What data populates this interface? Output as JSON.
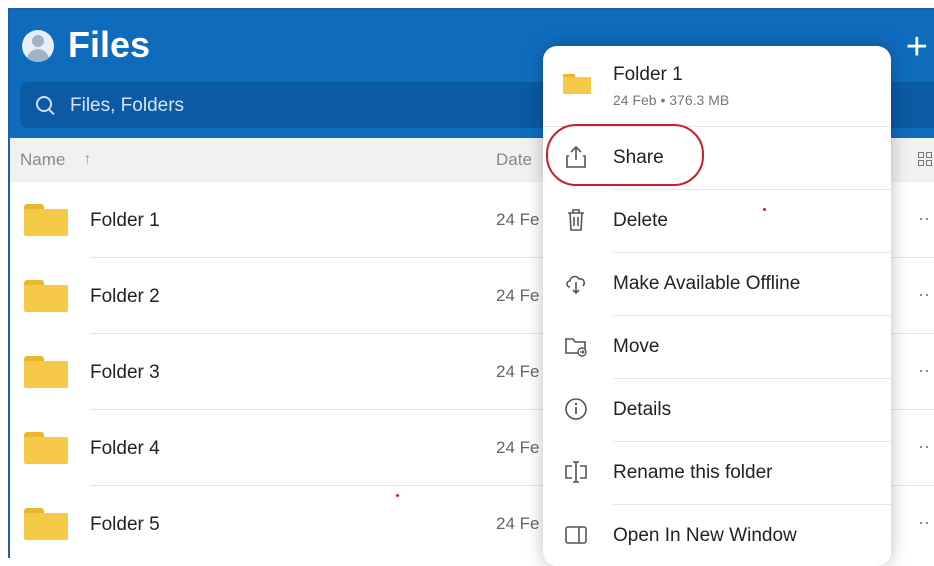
{
  "header": {
    "title": "Files",
    "plus_glyph": "+",
    "search_placeholder": "Files, Folders",
    "accent": "#0f6cbd"
  },
  "columns": {
    "name": "Name",
    "sort_glyph": "↑",
    "date": "Date"
  },
  "rows": [
    {
      "name": "Folder 1",
      "date": "24 Fe"
    },
    {
      "name": "Folder 2",
      "date": "24 Fe"
    },
    {
      "name": "Folder 3",
      "date": "24 Fe"
    },
    {
      "name": "Folder 4",
      "date": "24 Fe"
    },
    {
      "name": "Folder 5",
      "date": "24 Fe"
    }
  ],
  "more_glyph": "··",
  "context_menu": {
    "folder_name": "Folder 1",
    "folder_meta": "24 Feb • 376.3 MB",
    "items": [
      {
        "label": "Share",
        "icon": "share-icon"
      },
      {
        "label": "Delete",
        "icon": "trash-icon"
      },
      {
        "label": "Make Available Offline",
        "icon": "cloud-download-icon"
      },
      {
        "label": "Move",
        "icon": "move-folder-icon"
      },
      {
        "label": "Details",
        "icon": "info-icon"
      },
      {
        "label": "Rename this folder",
        "icon": "rename-icon"
      },
      {
        "label": "Open In New Window",
        "icon": "new-window-icon"
      }
    ],
    "highlight_color": "#c8202b"
  }
}
